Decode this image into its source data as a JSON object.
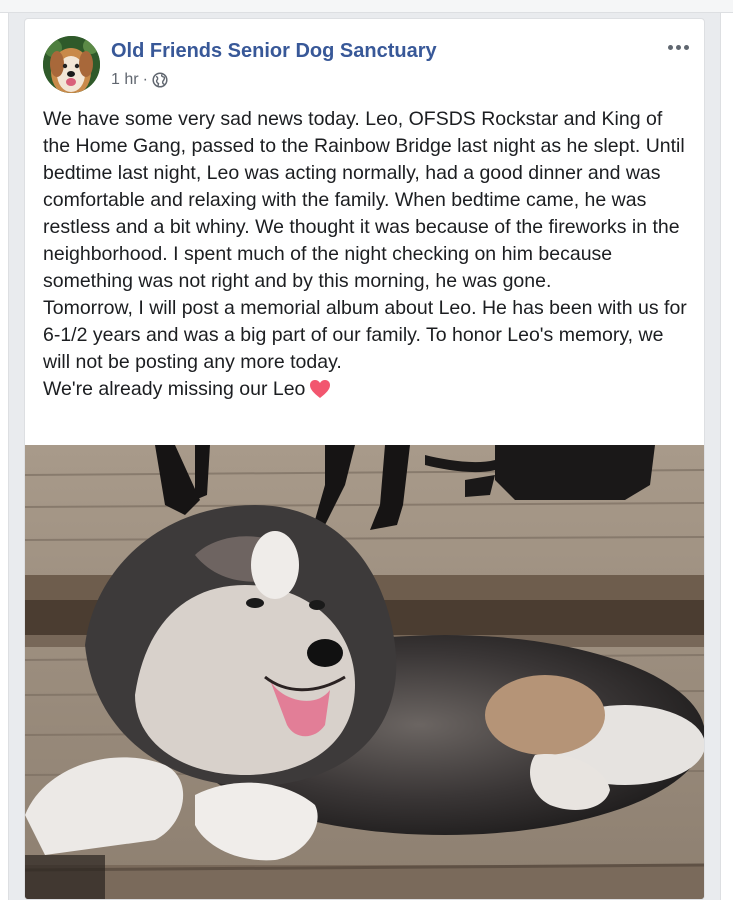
{
  "post": {
    "page_name": "Old Friends Senior Dog Sanctuary",
    "timestamp": "1 hr",
    "separator": "·",
    "privacy_icon": "globe-icon",
    "more_icon": "more-options-icon",
    "paragraphs": [
      "We have some very sad news today. Leo, OFSDS Rockstar and King of the Home Gang, passed to the Rainbow Bridge last night as he slept. Until bedtime last night, Leo was acting normally, had a good dinner and was comfortable and relaxing with the family. When bedtime came, he was restless and a bit whiny. We thought it was because of the fireworks in the neighborhood. I spent much of the night checking on him because something was not right and by this morning, he was gone.",
      "Tomorrow, I will post a memorial album about Leo. He has been with us for 6-1/2 years and was a big part of our family. To honor Leo's memory, we will not be posting any more today.",
      "We're already missing our Leo"
    ],
    "heart_icon": "heart-icon"
  },
  "colors": {
    "page_name": "#385898",
    "meta": "#616770",
    "text": "#1c1e21",
    "heart": "#f2566f",
    "background": "#e9ebee"
  }
}
